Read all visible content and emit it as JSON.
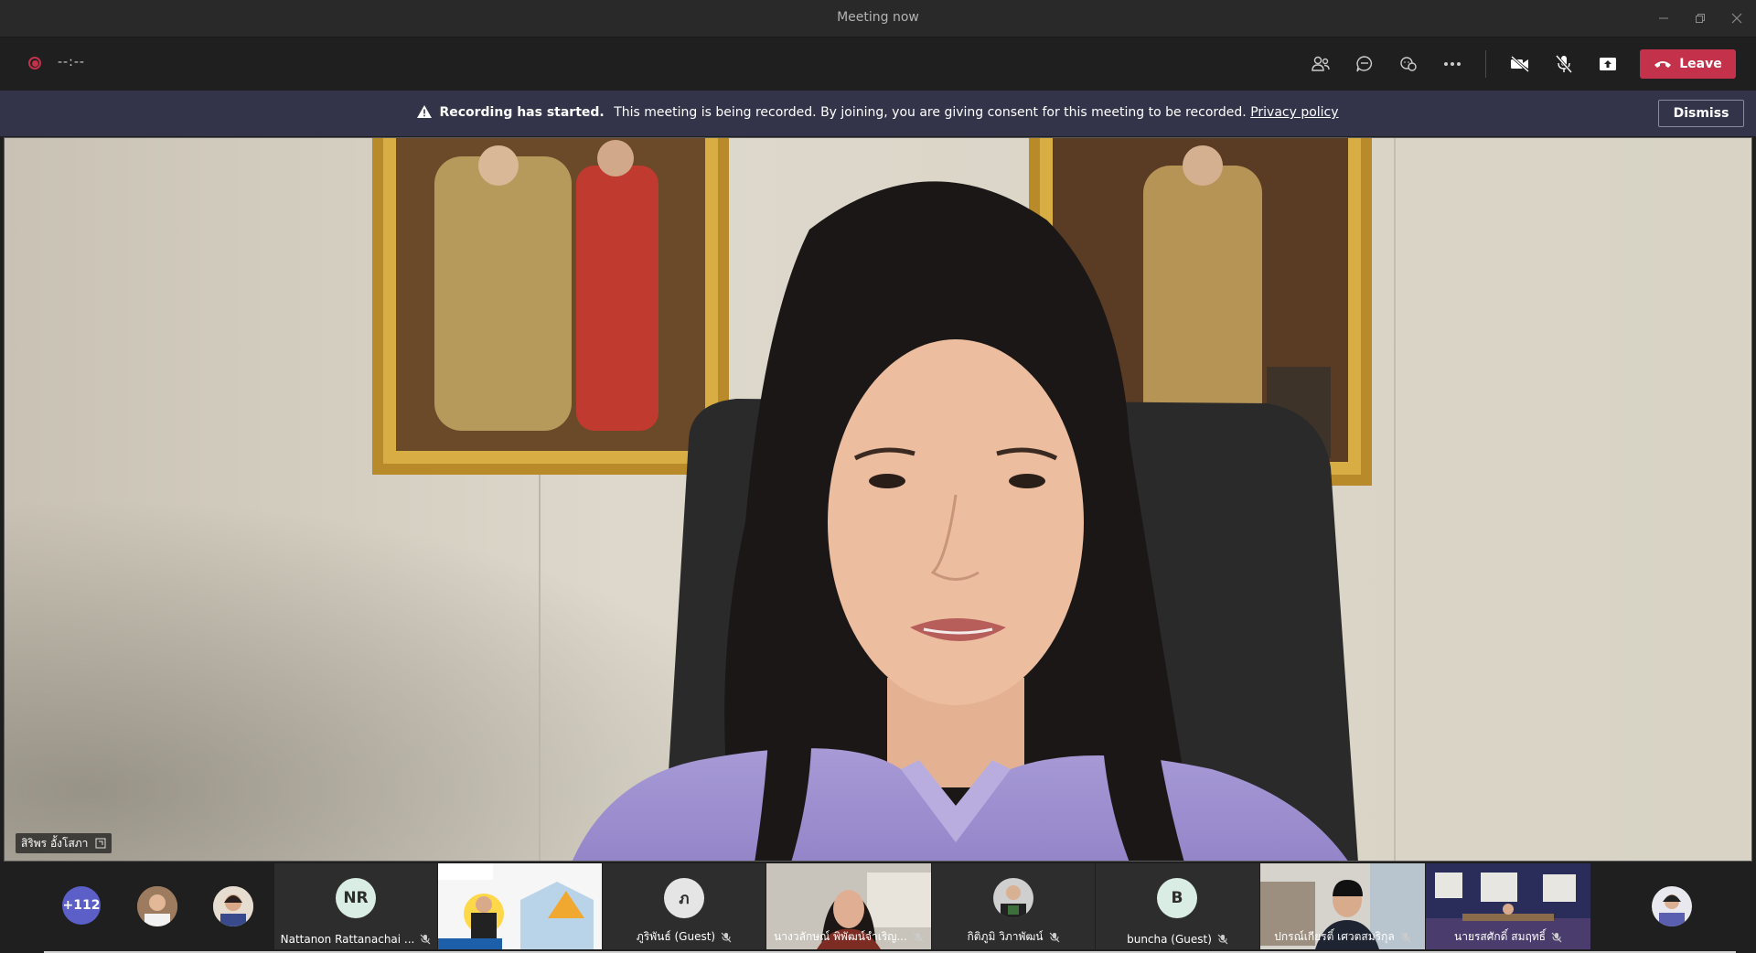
{
  "window": {
    "title": "Meeting now"
  },
  "toolbar": {
    "timer": "--:--",
    "leave_label": "Leave"
  },
  "banner": {
    "heading": "Recording has started.",
    "message": "This meeting is being recorded. By joining, you are giving consent for this meeting to be recorded.",
    "link": "Privacy policy",
    "dismiss_label": "Dismiss"
  },
  "main_video": {
    "speaker_name": "สิริพร อั้งโสภา"
  },
  "participants": {
    "overflow_count": "+112",
    "tiles": [
      {
        "name": "Nattanon Rattanachai ...",
        "initials": "NR"
      },
      {
        "name": "ภูริพันธ์ (Guest)",
        "initials": "ภ"
      },
      {
        "name": "นางวลักษณ์ พิพัฒน์จำเริญ...",
        "initials": ""
      },
      {
        "name": "กิติภูมิ วิภาพัฒน์",
        "initials": ""
      },
      {
        "name": "buncha (Guest)",
        "initials": "B"
      },
      {
        "name": "ปกรณ์เกียรติ์ เศวตสมริกุล",
        "initials": ""
      },
      {
        "name": "นายรสศักดิ์ สมฤทธิ์",
        "initials": ""
      }
    ]
  },
  "colors": {
    "leave": "#c4314b",
    "banner": "#33344a",
    "background": "#1f1f1f"
  }
}
